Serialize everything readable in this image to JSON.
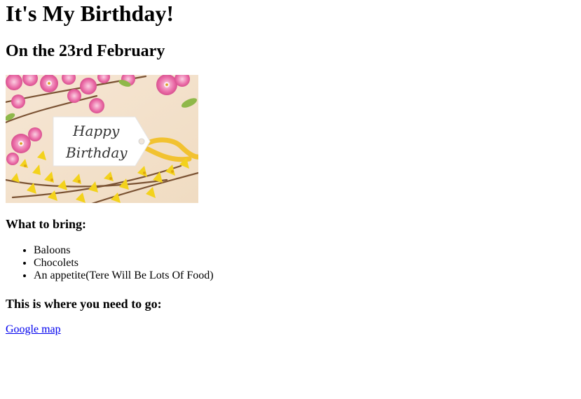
{
  "page": {
    "title": "It's My Birthday!",
    "subtitle": "On the 23rd February"
  },
  "banner": {
    "line1": "Happy",
    "line2": "Birthday"
  },
  "bring": {
    "heading": "What to bring:",
    "items": [
      "Baloons",
      "Chocolets",
      "An appetite(Tere Will Be Lots Of Food)"
    ]
  },
  "directions": {
    "heading": "This is where you need to go:",
    "link_label": "Google map"
  },
  "colors": {
    "link": "#0000ee",
    "ribbon": "#f2c230",
    "petal_pink": "#e8559a",
    "forsythia": "#f3d21c",
    "background": "#f3e3cf"
  }
}
